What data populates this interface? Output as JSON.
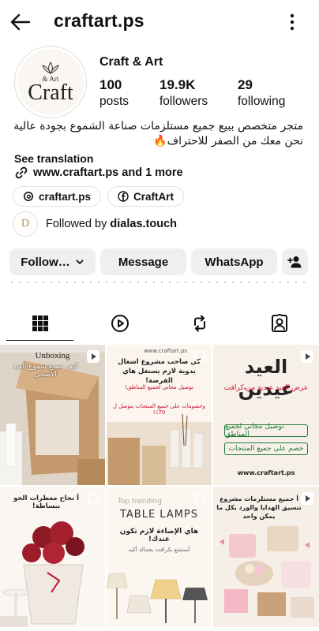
{
  "header": {
    "username": "craftart.ps"
  },
  "profile": {
    "avatar_text_small": "& Art",
    "avatar_text_big": "Craft",
    "display_name": "Craft & Art",
    "stats": [
      {
        "value": "100",
        "label": "posts"
      },
      {
        "value": "19.9K",
        "label": "followers"
      },
      {
        "value": "29",
        "label": "following"
      }
    ],
    "bio_line1": "متجر متخصص ببيع جميع مستلزمات صناعة الشموع بجودة عالية",
    "bio_line2": "نحن معك من الصفر للاحتراف🔥",
    "see_translation": "See translation",
    "link_text": "www.craftart.ps and 1 more",
    "chips": [
      {
        "icon": "threads-icon",
        "label": "craftart.ps"
      },
      {
        "icon": "facebook-icon",
        "label": "CraftArt"
      }
    ],
    "followed_by_prefix": "Followed by ",
    "followed_by_user": "dialas.touch",
    "followed_avatar_letter": "D"
  },
  "actions": {
    "follow_label": "Follow…",
    "message_label": "Message",
    "whatsapp_label": "WhatsApp"
  },
  "tabs": [
    {
      "icon": "grid-icon",
      "active": true
    },
    {
      "icon": "reels-icon",
      "active": false
    },
    {
      "icon": "reposts-icon",
      "active": false
    },
    {
      "icon": "tagged-icon",
      "active": false
    }
  ],
  "posts": {
    "p1": {
      "title": "Unboxing",
      "text": "كيف تصنع شموع العيد الأضحى"
    },
    "p2": {
      "site": "www.craftart.ps",
      "heading": "كل صاحب مشروع اشغال يدوية لازم يستغل هاي الفرصة!",
      "tag1": "توصيل مجاني لجميع المناطق!",
      "tag2": "وخصومات على جميع المنتجات بتوصل ل 70٪!"
    },
    "p3": {
      "title": "العيد عيدين",
      "subtitle": "عرض العيد عيدية من كرافت",
      "tag1": "توصيل مجاني لجميع المناطق",
      "tag2": "خصم على جميع المنتجات",
      "site": "www.craftart.ps"
    },
    "p4": {
      "text": "أ نجاح معطرات الجو ببساطة!"
    },
    "p5": {
      "top": "Top trending",
      "title": "TABLE LAMPS",
      "ar_title": "هاي الإضاءة لازم تكون عندك!",
      "ar_sub": "أستمتع بكرافت بجمالة أكيد"
    },
    "p6": {
      "text": "أ جميع مستلزمات مشروع تنسيق الهدايا والورد بكل ما يمكن واحد"
    }
  }
}
